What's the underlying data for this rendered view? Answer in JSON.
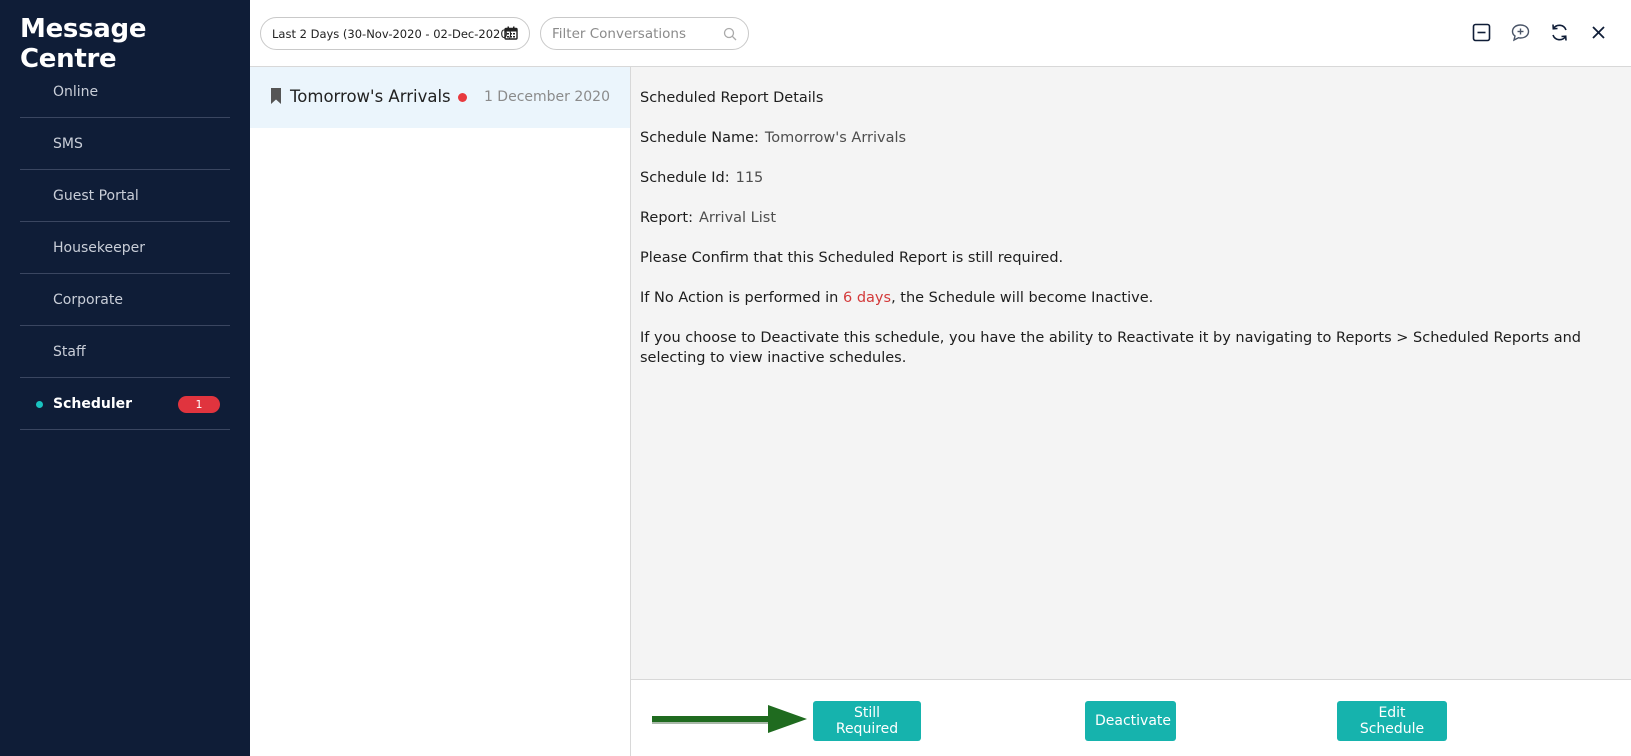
{
  "app": {
    "title": "Message Centre"
  },
  "sidebar": {
    "items": [
      {
        "label": "Online"
      },
      {
        "label": "SMS"
      },
      {
        "label": "Guest Portal"
      },
      {
        "label": "Housekeeper"
      },
      {
        "label": "Corporate"
      },
      {
        "label": "Staff"
      },
      {
        "label": "Scheduler",
        "badge": "1",
        "active": true
      }
    ]
  },
  "topbar": {
    "date_range": "Last 2 Days (30-Nov-2020 - 02-Dec-2020)",
    "filter_placeholder": "Filter Conversations",
    "icons": [
      "minimize-icon",
      "new-message-icon",
      "refresh-icon",
      "close-icon"
    ]
  },
  "conversations": [
    {
      "title": "Tomorrow's Arrivals",
      "date": "1 December 2020",
      "unread": true
    }
  ],
  "details": {
    "heading": "Scheduled Report Details",
    "schedule_name_label": "Schedule Name:",
    "schedule_name": "Tomorrow's Arrivals",
    "schedule_id_label": "Schedule Id:",
    "schedule_id": "115",
    "report_label": "Report:",
    "report": "Arrival List",
    "confirm_text": "Please Confirm that this Scheduled Report is still required.",
    "no_action_prefix": "If No Action is performed in ",
    "no_action_days": "6 days",
    "no_action_suffix": ", the Schedule will become Inactive.",
    "deactivate_info": "If you choose to Deactivate this schedule, you have the ability to Reactivate it by navigating to Reports > Scheduled Reports and selecting to view inactive schedules."
  },
  "actions": {
    "still_required": "Still Required",
    "deactivate": "Deactivate",
    "edit_schedule": "Edit Schedule"
  },
  "colors": {
    "sidebar_bg": "#0f1d37",
    "accent": "#16b3ad",
    "badge": "#e0343e",
    "warning_text": "#d33a3a",
    "annotation_arrow": "#1f6b1f"
  }
}
